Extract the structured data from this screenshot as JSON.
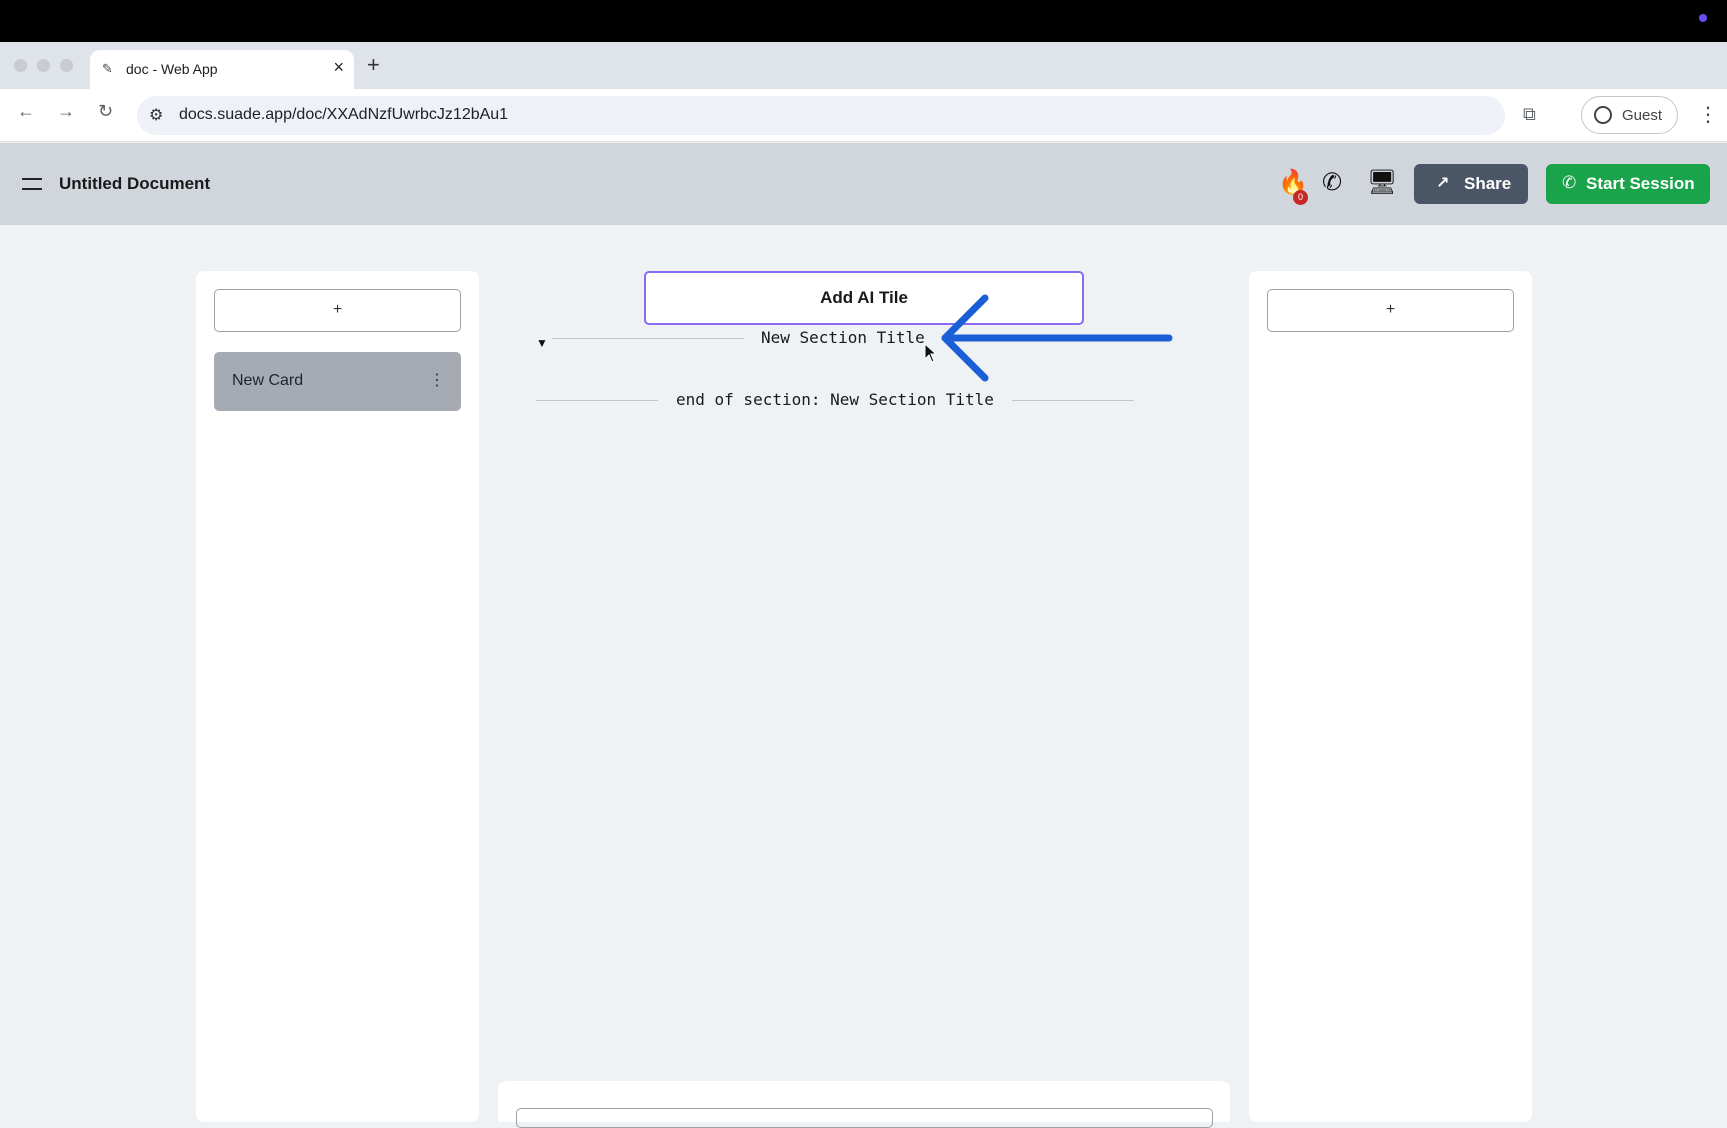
{
  "browser": {
    "tab_title": "doc - Web App",
    "tab_favicon": "pen-icon",
    "url": "docs.suade.app/doc/XXAdNzfUwrbcJz12bAu1",
    "profile_label": "Guest"
  },
  "app": {
    "doc_title": "Untitled Document",
    "notification_count": "0",
    "share_label": "Share",
    "start_session_label": "Start Session"
  },
  "left_panel": {
    "add_label": "+",
    "cards": [
      {
        "label": "New Card"
      }
    ]
  },
  "right_panel": {
    "add_label": "+"
  },
  "editor": {
    "add_ai_tile_label": "Add AI Tile",
    "section_title": "New Section Title",
    "section_end": "end of section: New Section Title"
  },
  "annotation": {
    "arrow_color": "#1a5fd6"
  },
  "colors": {
    "accent_green": "#19a34a",
    "share_dark": "#4a5566",
    "ai_tile_border": "#8b6cf0",
    "badge_red": "#c62828"
  }
}
